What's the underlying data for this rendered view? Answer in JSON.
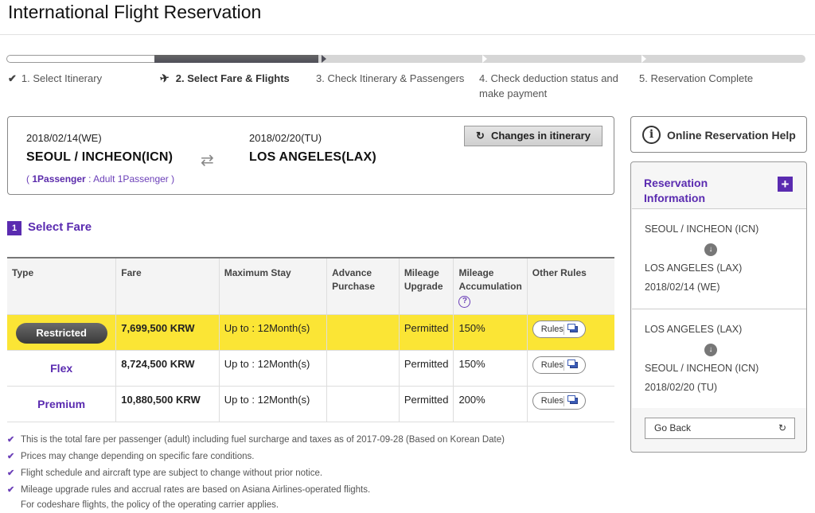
{
  "page": {
    "title": "International Flight Reservation"
  },
  "steps": [
    {
      "label": "1. Select Itinerary"
    },
    {
      "label": "2. Select Fare & Flights"
    },
    {
      "label": "3. Check Itinerary & Passengers"
    },
    {
      "label": "4. Check deduction status and make payment"
    },
    {
      "label": "5. Reservation Complete"
    }
  ],
  "itinerary": {
    "depart_date": "2018/02/14(WE)",
    "return_date": "2018/02/20(TU)",
    "origin": "SEOUL / INCHEON(ICN)",
    "destination": "LOS ANGELES(LAX)",
    "pax_open": "( ",
    "pax_count": "1Passenger",
    "pax_detail": " : Adult 1Passenger )",
    "change_label": "Changes in itinerary"
  },
  "select_fare": {
    "number": "1",
    "title": "Select Fare",
    "headers": [
      "Type",
      "Fare",
      "Maximum Stay",
      "Advance Purchase",
      "Mileage Upgrade",
      "Mileage Accumulation",
      "Other Rules"
    ],
    "rows": [
      {
        "type": "Restricted",
        "fare": "7,699,500 KRW",
        "max_stay": "Up to : 12Month(s)",
        "advance": "",
        "upgrade": "Permitted",
        "accumulation": "150%",
        "rules": "Rules",
        "selected": true
      },
      {
        "type": "Flex",
        "fare": "8,724,500 KRW",
        "max_stay": "Up to : 12Month(s)",
        "advance": "",
        "upgrade": "Permitted",
        "accumulation": "150%",
        "rules": "Rules",
        "selected": false
      },
      {
        "type": "Premium",
        "fare": "10,880,500 KRW",
        "max_stay": "Up to : 12Month(s)",
        "advance": "",
        "upgrade": "Permitted",
        "accumulation": "200%",
        "rules": "Rules",
        "selected": false
      }
    ],
    "help_glyph": "?"
  },
  "notes": [
    "This is the total fare per passenger (adult) including fuel surcharge and taxes as of 2017-09-28 (Based on Korean Date)",
    "Prices may change depending on specific fare conditions.",
    "Flight schedule and aircraft type are subject to change without prior notice.",
    "Mileage upgrade rules and accrual rates are based on Asiana Airlines-operated flights."
  ],
  "notes_continuation": "For codeshare flights, the policy of the operating carrier applies.",
  "sidebar": {
    "help_label": "Online Reservation Help",
    "reservation_title": "Reservation Information",
    "segments": [
      {
        "from": "SEOUL / INCHEON (ICN)",
        "to": "LOS ANGELES (LAX)",
        "date": "2018/02/14 (WE)"
      },
      {
        "from": "LOS ANGELES (LAX)",
        "to": "SEOUL / INCHEON (ICN)",
        "date": "2018/02/20 (TU)"
      }
    ],
    "go_back_label": "Go Back"
  },
  "colors": {
    "accent": "#5a2bb0",
    "selected_row": "#fbe535"
  },
  "icons": [
    "check-icon",
    "plane-icon",
    "swap-arrows-icon",
    "refresh-icon",
    "help-circle-icon",
    "rules-window-icon",
    "info-icon",
    "plus-icon",
    "arrow-down-circle-icon"
  ]
}
